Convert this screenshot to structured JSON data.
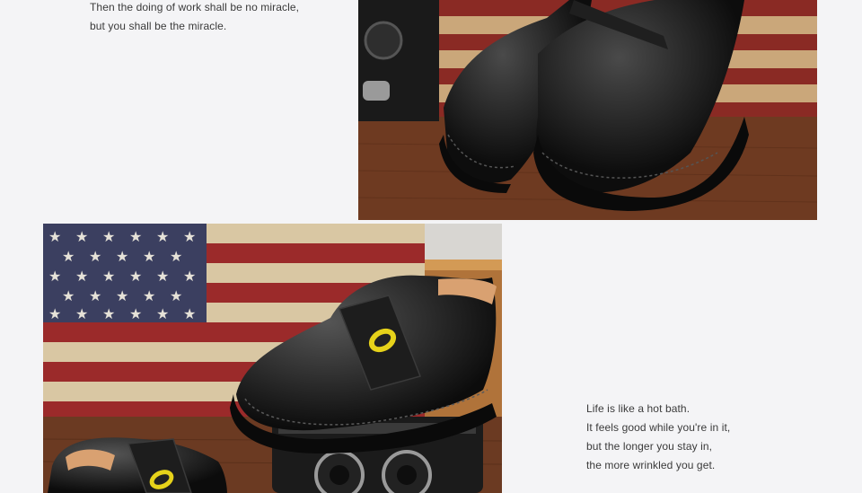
{
  "quote_top": {
    "line1": "Then the doing of work shall be no miracle,",
    "line2": "but you shall be the miracle."
  },
  "quote_bottom": {
    "line1": "Life is like a hot bath.",
    "line2": "It feels good while you're in it,",
    "line3": "but the longer you stay in,",
    "line4": "the more wrinkled you get."
  },
  "colors": {
    "background": "#f4f4f6",
    "text": "#3a3a3a",
    "leather": "#111111",
    "wood": "#6b3a22",
    "flag_red": "#9b2a2a",
    "flag_blue": "#3b3f60",
    "logo_yellow": "#e6d21a"
  }
}
